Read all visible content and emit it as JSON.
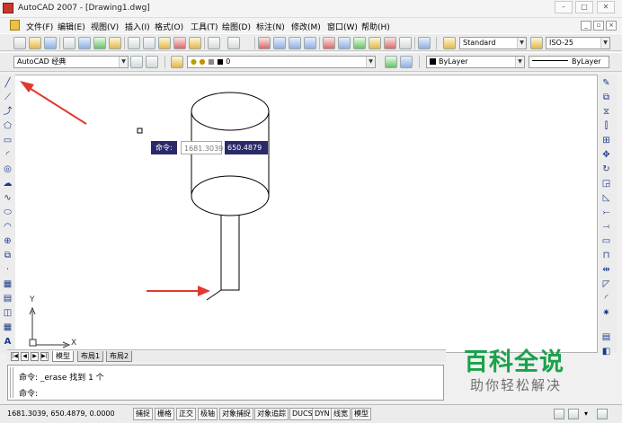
{
  "window": {
    "title": "AutoCAD 2007 - [Drawing1.dwg]"
  },
  "menu": [
    {
      "label": "文件(F)"
    },
    {
      "label": "编辑(E)"
    },
    {
      "label": "视图(V)"
    },
    {
      "label": "插入(I)"
    },
    {
      "label": "格式(O)"
    },
    {
      "label": "工具(T)"
    },
    {
      "label": "绘图(D)"
    },
    {
      "label": "标注(N)"
    },
    {
      "label": "修改(M)"
    },
    {
      "label": "窗口(W)"
    },
    {
      "label": "帮助(H)"
    }
  ],
  "toolbar": {
    "text_style": "Standard",
    "dim_style": "ISO-25",
    "workspace": "AutoCAD 经典",
    "layer": "0",
    "color": "ByLayer",
    "linetype": "ByLayer",
    "lineweight": "ByLayer"
  },
  "dynamic_input": {
    "label": "命令:",
    "x_value": "1681.3039",
    "y_value": "650.4879"
  },
  "ucs": {
    "x_label": "X",
    "y_label": "Y"
  },
  "layout_tabs": {
    "model": "模型",
    "layout1": "布局1",
    "layout2": "布局2"
  },
  "command": {
    "history_line": "命令:  _erase 找到 1 个",
    "prompt": "命令:"
  },
  "status": {
    "coordinates": "1681.3039,  650.4879,  0.0000",
    "buttons": [
      {
        "label": "捕捉"
      },
      {
        "label": "栅格"
      },
      {
        "label": "正交"
      },
      {
        "label": "极轴"
      },
      {
        "label": "对象捕捉"
      },
      {
        "label": "对象追踪"
      },
      {
        "label": "DUCS"
      },
      {
        "label": "DYN"
      },
      {
        "label": "线宽"
      },
      {
        "label": "模型"
      }
    ]
  },
  "watermark": {
    "title": "百科全说",
    "subtitle": "助你轻松解决"
  },
  "colors": {
    "arrow": "#e03a2f",
    "dyn_bg": "#2a2a6a",
    "watermark_green": "#1aa14b"
  }
}
